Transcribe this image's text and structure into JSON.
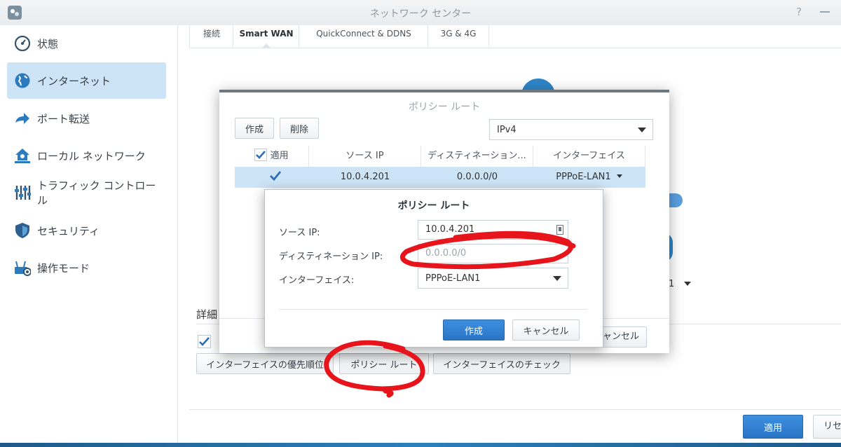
{
  "window": {
    "title": "ネットワーク センター",
    "help_label": "?",
    "app_icon": "network-center-icon"
  },
  "sidebar": {
    "items": [
      {
        "label": "状態",
        "icon": "gauge-icon"
      },
      {
        "label": "インターネット",
        "icon": "globe-icon",
        "active": true
      },
      {
        "label": "ポート転送",
        "icon": "arrow-right-icon"
      },
      {
        "label": "ローカル ネットワーク",
        "icon": "home-network-icon"
      },
      {
        "label": "トラフィック コントロール",
        "icon": "sliders-icon"
      },
      {
        "label": "セキュリティ",
        "icon": "shield-icon"
      },
      {
        "label": "操作モード",
        "icon": "router-icon"
      }
    ]
  },
  "main": {
    "tabs": [
      {
        "label": "接続"
      },
      {
        "label": "Smart WAN",
        "active": true
      },
      {
        "label": "QuickConnect & DDNS"
      },
      {
        "label": "3G & 4G"
      }
    ],
    "details_label": "詳細",
    "fragment_value": "1",
    "buttons": {
      "priority": "インターフェイスの優先順位",
      "policy_route": "ポリシー ルート",
      "check": "インターフェイスのチェック",
      "apply": "適用",
      "reset": "リセ"
    }
  },
  "policy_route_dialog": {
    "title": "ポリシー ルート",
    "create_label": "作成",
    "delete_label": "削除",
    "ip_version": "IPv4",
    "columns": [
      "適用",
      "ソース IP",
      "ディスティネーション...",
      "インターフェイス"
    ],
    "rows": [
      {
        "enabled": true,
        "source_ip": "10.0.4.201",
        "destination": "0.0.0.0/0",
        "interface": "PPPoE-LAN1"
      }
    ],
    "cancel_label": "ャンセル"
  },
  "edit_dialog": {
    "title": "ポリシー ルート",
    "source_ip_label": "ソース IP:",
    "source_ip_value": "10.0.4.201",
    "destination_ip_label": "ディスティネーション IP:",
    "destination_ip_placeholder": "0.0.0.0/0",
    "interface_label": "インターフェイス:",
    "interface_value": "PPPoE-LAN1",
    "create_label": "作成",
    "cancel_label": "キャンセル"
  },
  "colors": {
    "accent": "#2a74c5",
    "selection": "#cde3f6",
    "annotation": "#e8141c"
  }
}
